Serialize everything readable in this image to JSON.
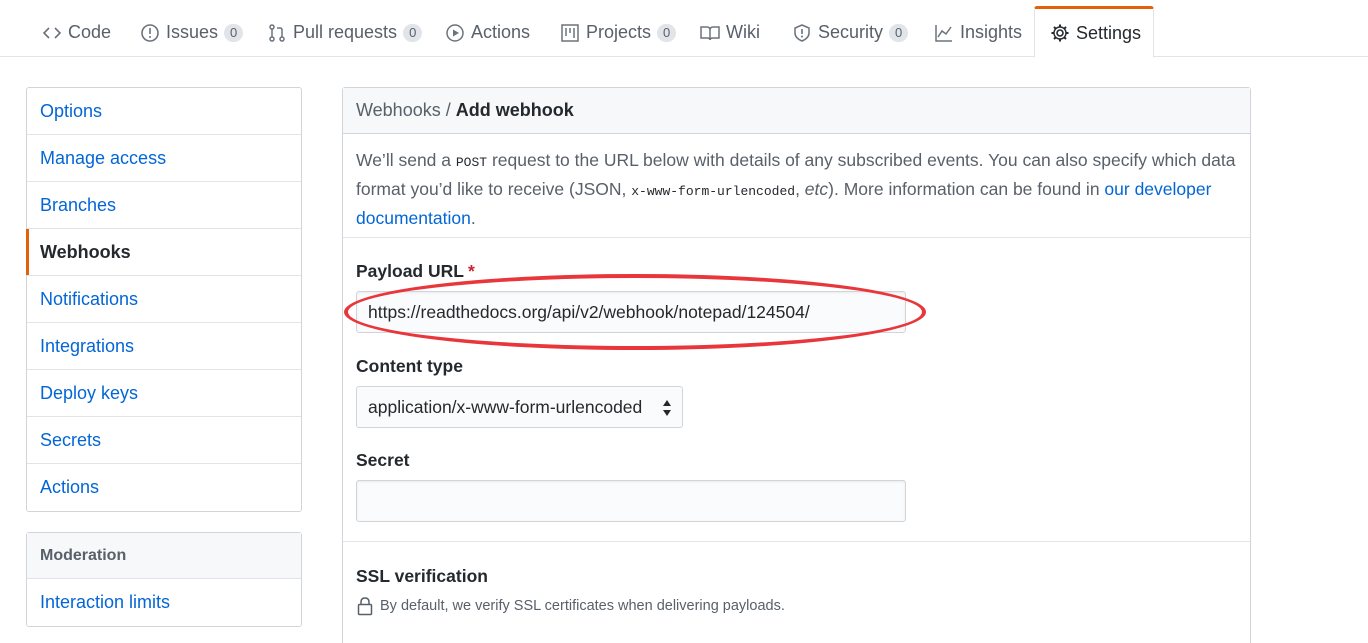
{
  "tabs": [
    {
      "label": "Code",
      "icon": "code-icon"
    },
    {
      "label": "Issues",
      "icon": "issue-icon",
      "count": "0"
    },
    {
      "label": "Pull requests",
      "icon": "pull-request-icon",
      "count": "0"
    },
    {
      "label": "Actions",
      "icon": "play-icon"
    },
    {
      "label": "Projects",
      "icon": "project-icon",
      "count": "0"
    },
    {
      "label": "Wiki",
      "icon": "book-icon"
    },
    {
      "label": "Security",
      "icon": "shield-icon",
      "count": "0"
    },
    {
      "label": "Insights",
      "icon": "graph-icon"
    },
    {
      "label": "Settings",
      "icon": "gear-icon",
      "selected": true
    }
  ],
  "sidebar": {
    "items": [
      {
        "label": "Options"
      },
      {
        "label": "Manage access"
      },
      {
        "label": "Branches"
      },
      {
        "label": "Webhooks",
        "selected": true
      },
      {
        "label": "Notifications"
      },
      {
        "label": "Integrations"
      },
      {
        "label": "Deploy keys"
      },
      {
        "label": "Secrets"
      },
      {
        "label": "Actions"
      }
    ],
    "moderation": {
      "heading": "Moderation",
      "items": [
        {
          "label": "Interaction limits"
        }
      ]
    }
  },
  "main": {
    "breadcrumb": {
      "parent": "Webhooks",
      "separator": "/",
      "current": "Add webhook"
    },
    "intro": {
      "part1": "We’ll send a ",
      "code1": "POST",
      "part2": " request to the URL below with details of any subscribed events. You can also specify which data format you’d like to receive (JSON, ",
      "code2": "x-www-form-urlencoded",
      "part3": ", ",
      "etc": "etc",
      "part4": "). More information can be found in ",
      "link": "our developer documentation",
      "part5": "."
    },
    "payload_url": {
      "label": "Payload URL",
      "required_mark": "*",
      "value": "https://readthedocs.org/api/v2/webhook/notepad/124504/"
    },
    "content_type": {
      "label": "Content type",
      "value": "application/x-www-form-urlencoded"
    },
    "secret": {
      "label": "Secret",
      "value": ""
    },
    "ssl": {
      "label": "SSL verification",
      "note": "By default, we verify SSL certificates when delivering payloads."
    }
  },
  "colors": {
    "accent": "#e36209",
    "link": "#0366d6",
    "annotation": "#e8363b"
  }
}
